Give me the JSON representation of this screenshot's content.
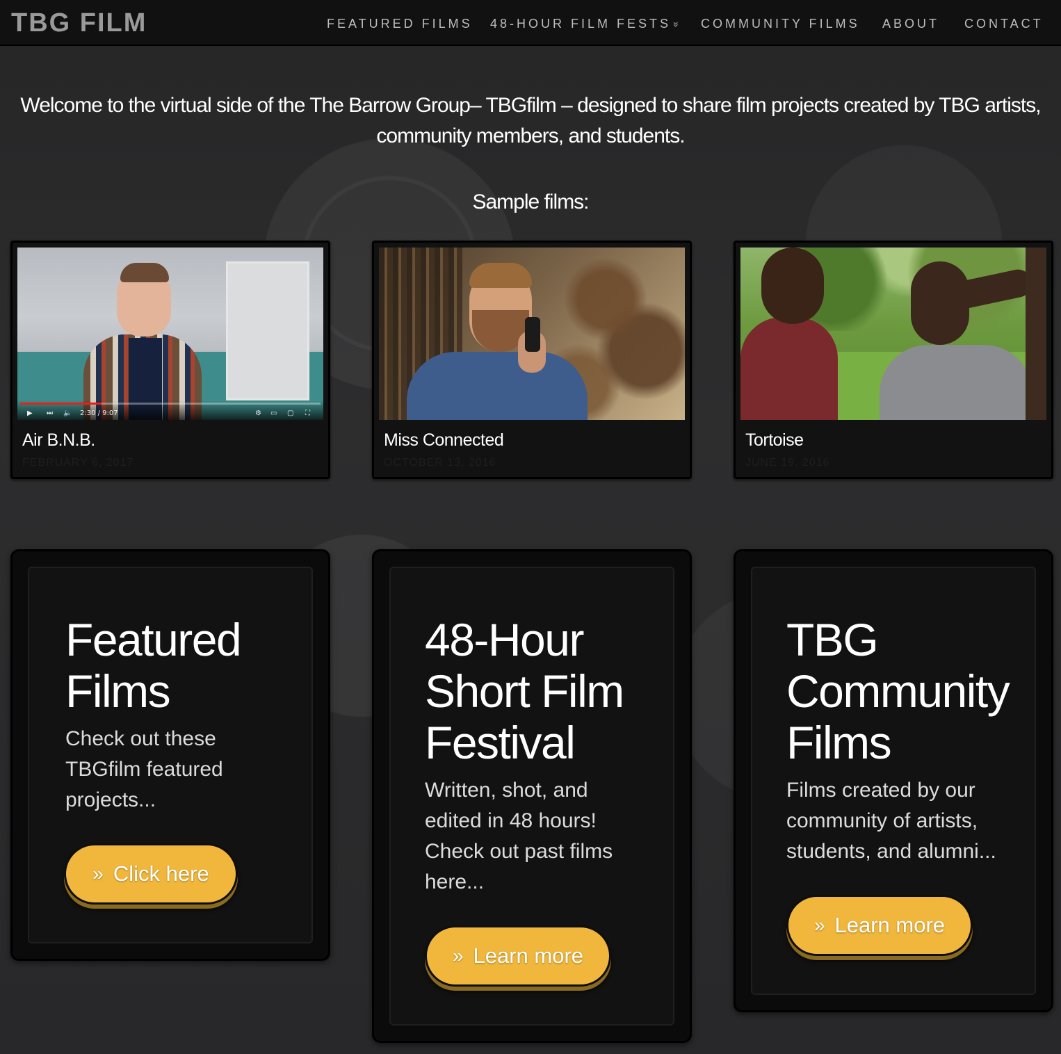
{
  "nav": {
    "logo": "TBG FILM",
    "items": [
      {
        "label": "FEATURED FILMS"
      },
      {
        "label": "48-HOUR FILM FESTS",
        "chevron": "»"
      },
      {
        "label": "COMMUNITY FILMS"
      },
      {
        "label": "ABOUT"
      },
      {
        "label": "CONTACT"
      }
    ]
  },
  "intro": {
    "line1": "Welcome to the virtual side of the The Barrow Group– TBGfilm – designed to share film projects created by TBG artists,",
    "line2": "community members, and students.",
    "sample_heading": "Sample films:"
  },
  "films": [
    {
      "title": "Air B.N.B.",
      "date": "FEBRUARY 6, 2017",
      "player": {
        "time": "2:30 / 9:07",
        "progress": 0.27
      }
    },
    {
      "title": "Miss Connected",
      "date": "OCTOBER 13, 2016"
    },
    {
      "title": "Tortoise",
      "date": "JUNE 19, 2016"
    }
  ],
  "features": [
    {
      "title_lines": [
        "Featured",
        "Films"
      ],
      "desc_lines": [
        "Check out these",
        "TBGfilm featured",
        "projects..."
      ],
      "button": "Click here",
      "button_icon": "double-chevron-right-icon"
    },
    {
      "title_lines": [
        "48-Hour",
        "Short Film",
        "Festival"
      ],
      "desc_lines": [
        "Written, shot, and",
        "edited in 48 hours!",
        "Check out past films",
        "here..."
      ],
      "button": "Learn more",
      "button_icon": "double-chevron-right-icon"
    },
    {
      "title_lines": [
        "TBG",
        "Community",
        "Films"
      ],
      "desc_lines": [
        "Films created by our",
        "community of artists,",
        "students, and alumni..."
      ],
      "button": "Learn more",
      "button_icon": "double-chevron-right-icon"
    }
  ],
  "colors": {
    "accent": "#f0b73c",
    "background": "#2a2a2b",
    "navbar": "#111111",
    "card": "#121212"
  }
}
